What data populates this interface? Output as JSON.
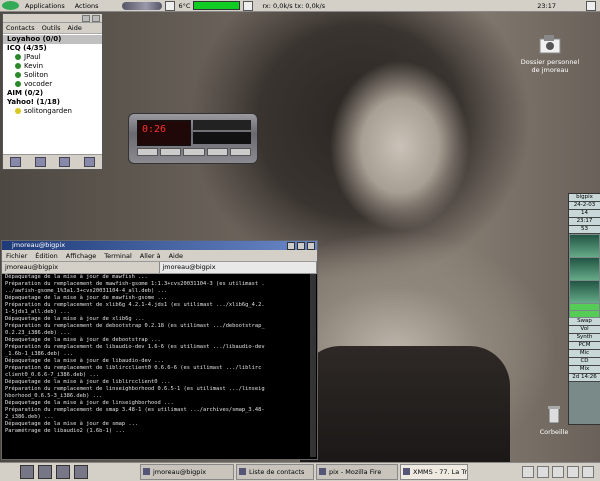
{
  "top_panel": {
    "menu": [
      "Applications",
      "Actions"
    ],
    "temperature": "6°C",
    "network": "rx: 0,0k/s tx: 0,0k/s",
    "clock": "23:17"
  },
  "desktop": {
    "home_icon_label": "Dossier personnel de jmoreau",
    "trash_label": "Corbeille"
  },
  "contacts": {
    "menu": [
      "Contacts",
      "Outils",
      "Aide"
    ],
    "rows": [
      {
        "label": "Loyahoo (0/0)",
        "kind": "sel"
      },
      {
        "label": "ICQ (4/35)",
        "kind": "group"
      },
      {
        "label": "JPaul",
        "kind": "buddy"
      },
      {
        "label": "Kevin",
        "kind": "buddy"
      },
      {
        "label": "Soliton",
        "kind": "buddy"
      },
      {
        "label": "vocoder",
        "kind": "buddy"
      },
      {
        "label": "AIM (0/2)",
        "kind": "group"
      },
      {
        "label": "Yahoo! (1/18)",
        "kind": "group"
      },
      {
        "label": "solitongarden",
        "kind": "yahoo"
      }
    ]
  },
  "xmms": {
    "time": "0:26"
  },
  "terminal": {
    "title": "jmoreau@bigpix",
    "menu": [
      "Fichier",
      "Édition",
      "Affichage",
      "Terminal",
      "Aller à",
      "Aide"
    ],
    "tabs": [
      "jmoreau@bigpix",
      "jmoreau@bigpix"
    ],
    "lines": [
      "Dépaquetage de la mise à jour de mawfish ...",
      "Préparation du remplacement de mawfish-gsome 1:1.3+cvs20031104-3 (es utilimast .",
      "../awfish-gsome_1%3a1.3+cvs20031104-4_all.deb) ...",
      "Dépaquetage de la mise à jour de mawfish-gsome ...",
      "Préparation du remplacement de xlib6g 4.2.1-4.jds1 (es utilimast .../xlib6g_4.2.",
      "1-5jds1_all.deb) ...",
      "Dépaquetage de la mise à jour de xlib6g ...",
      "Préparation du remplacement de debootstrap 0.2.18 (es utilimast .../debootstrap_",
      "0.2.23_i386.deb) ...",
      "Dépaquetage de la mise à jour de debootstrap ...",
      "Préparation du remplacement de libaudio-dev 1.6-6 (es utilimast .../libaudio-dev",
      "_1.6b-1_i386.deb) ...",
      "Dépaquetage de la mise à jour de libaudio-dev ...",
      "Préparation du remplacement de liblircclient0 0.6.6-6 (es utilimast .../liblirc",
      "client0_0.6.6-7_i386.deb) ...",
      "Dépaquetage de la mise à jour de liblircclient0 ...",
      "Préparation du remplacement de linseighborhood 0.6.5-1 (es utilimast .../linseig",
      "hborhood_0.6.5-3_i386.deb) ...",
      "Dépaquetage de la mise à jour de linseighborhood ...",
      "Préparation du remplacement de smap 3.48-1 (es utilimast .../archives/smap_3.48-",
      "2_i386.deb) ...",
      "Dépaquetage de la mise à jour de smap ...",
      "Paramétrage de libaudio2 (1.6b-1) ..."
    ]
  },
  "monitors": {
    "host": "bigpix",
    "date": "24-2-03",
    "day": "14",
    "time": "23:17",
    "temp": "53",
    "labels": [
      "Swap",
      "Vol",
      "Synth",
      "PCM",
      "Mic",
      "CD",
      "Mix"
    ],
    "uptime": "2d 14:26"
  },
  "taskbar": {
    "tasks": [
      {
        "label": "jmoreau@bigpix",
        "active": false
      },
      {
        "label": "Liste de contacts",
        "active": false
      },
      {
        "label": "pix - Mozilla Fire",
        "active": false
      },
      {
        "label": "XMMS - 77. La Tr",
        "active": true
      }
    ]
  }
}
